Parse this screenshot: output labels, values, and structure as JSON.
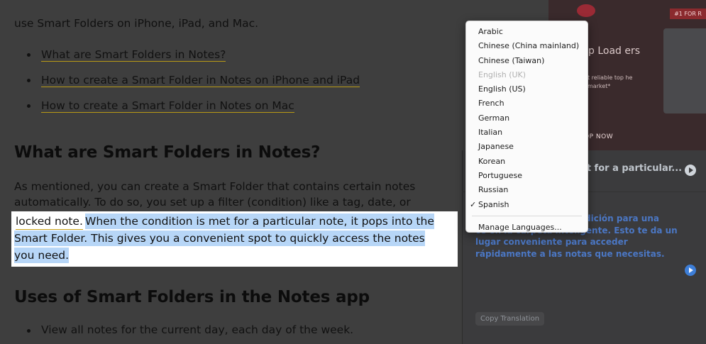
{
  "article": {
    "intro": "use Smart Folders on iPhone, iPad, and Mac.",
    "toc": [
      "What are Smart Folders in Notes?",
      "How to create a Smart Folder in Notes on iPhone and iPad",
      "How to create a Smart Folder in Notes on Mac"
    ],
    "heading1": "What are Smart Folders in Notes?",
    "para_line1": "As mentioned, you can create a Smart Folder that contains certain notes",
    "para_line2": "automatically. To do so, you set up a filter (condition) like a tag, date, or",
    "selection": {
      "prefix": "locked note.",
      "line1": "When the condition is met for a particular note, it pops into the",
      "line2": "Smart Folder. This gives you a convenient spot to quickly access the notes",
      "line3": "you need."
    },
    "heading2": "Uses of Smart Folders in the Notes app",
    "bullet": "View all notes for the current day, each day of the week."
  },
  "ad": {
    "badge": "#1 FOR R",
    "title": "p Load ers",
    "sub": "t reliable top he market*",
    "cta": "OP NOW"
  },
  "translation": {
    "source_snippet": "et for a particular...",
    "translated_text_lead": "dición para una",
    "translated_text_rest": "ce en la carpeta inteligente. Esto te da un lugar conveniente para acceder rápidamente a las notas que necesitas.",
    "copy_button": "Copy Translation"
  },
  "language_menu": {
    "items": [
      {
        "label": "Arabic",
        "state": "normal"
      },
      {
        "label": "Chinese (China mainland)",
        "state": "normal"
      },
      {
        "label": "Chinese (Taiwan)",
        "state": "normal"
      },
      {
        "label": "English (UK)",
        "state": "disabled"
      },
      {
        "label": "English (US)",
        "state": "normal"
      },
      {
        "label": "French",
        "state": "normal"
      },
      {
        "label": "German",
        "state": "normal"
      },
      {
        "label": "Italian",
        "state": "normal"
      },
      {
        "label": "Japanese",
        "state": "normal"
      },
      {
        "label": "Korean",
        "state": "normal"
      },
      {
        "label": "Portuguese",
        "state": "normal"
      },
      {
        "label": "Russian",
        "state": "normal"
      },
      {
        "label": "Spanish",
        "state": "checked"
      }
    ],
    "checkmark": "✓",
    "manage": "Manage Languages..."
  }
}
